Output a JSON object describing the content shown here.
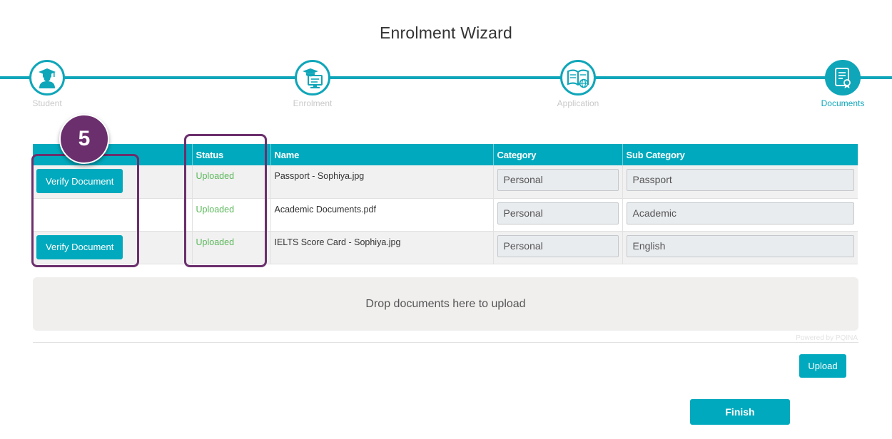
{
  "page": {
    "title": "Enrolment Wizard"
  },
  "colors": {
    "accent": "#00a9bd",
    "status_ok": "#5cb85c",
    "annotation": "#6b2f6d"
  },
  "wizard": {
    "steps": [
      {
        "label": "Student",
        "icon": "student-icon",
        "active": false
      },
      {
        "label": "Enrolment",
        "icon": "enrolment-icon",
        "active": false
      },
      {
        "label": "Application",
        "icon": "application-icon",
        "active": false
      },
      {
        "label": "Documents",
        "icon": "documents-icon",
        "active": true
      }
    ]
  },
  "table": {
    "headers": [
      "",
      "Status",
      "Name",
      "Category",
      "Sub Category"
    ],
    "rows": [
      {
        "action": "Verify Document",
        "status": "Uploaded",
        "name": "Passport - Sophiya.jpg",
        "category": "Personal",
        "sub_category": "Passport"
      },
      {
        "action": "",
        "status": "Uploaded",
        "name": "Academic Documents.pdf",
        "category": "Personal",
        "sub_category": "Academic"
      },
      {
        "action": "Verify Document",
        "status": "Uploaded",
        "name": "IELTS Score Card - Sophiya.jpg",
        "category": "Personal",
        "sub_category": "English"
      }
    ]
  },
  "dropzone": {
    "label": "Drop documents here to upload",
    "powered_by": "Powered by PQINA"
  },
  "buttons": {
    "upload": "Upload",
    "finish": "Finish"
  },
  "annotation": {
    "badge": "5"
  }
}
